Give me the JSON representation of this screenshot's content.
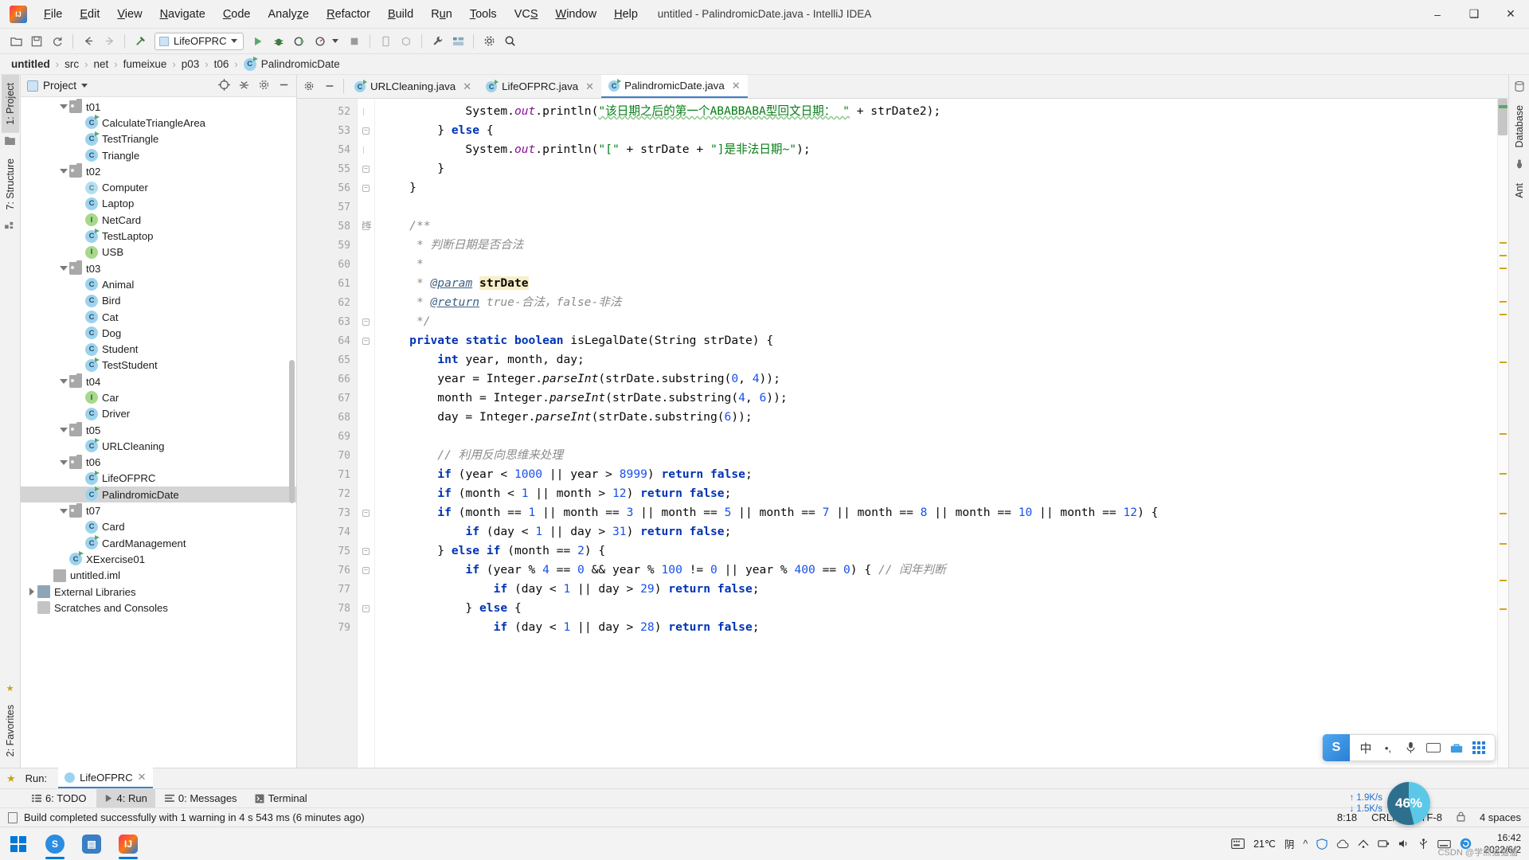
{
  "window": {
    "title": "untitled - PalindromicDate.java - IntelliJ IDEA",
    "minimize": "–",
    "maximize": "❐",
    "close": "✕"
  },
  "menu": [
    {
      "label": "File"
    },
    {
      "label": "Edit"
    },
    {
      "label": "View"
    },
    {
      "label": "Navigate"
    },
    {
      "label": "Code"
    },
    {
      "label": "Analyze"
    },
    {
      "label": "Refactor"
    },
    {
      "label": "Build"
    },
    {
      "label": "Run"
    },
    {
      "label": "Tools"
    },
    {
      "label": "VCS"
    },
    {
      "label": "Window"
    },
    {
      "label": "Help"
    }
  ],
  "toolbar": {
    "run_config": "LifeOFPRC",
    "icons": [
      "open-folder-icon",
      "save-icon",
      "sync-icon",
      "back-arrow-icon",
      "forward-arrow-icon",
      "build-hammer-icon"
    ],
    "right_icons": [
      "run-icon",
      "debug-icon",
      "run-with-coverage-icon",
      "profile-icon",
      "stop-icon",
      "device-icon",
      "avd-manager-icon",
      "wrench-icon",
      "structure-icon",
      "settings-gear-icon",
      "search-icon"
    ]
  },
  "breadcrumb": {
    "separator": "›",
    "items": [
      {
        "label": "untitled",
        "bold": true
      },
      {
        "label": "src"
      },
      {
        "label": "net"
      },
      {
        "label": "fumeixue"
      },
      {
        "label": "p03"
      },
      {
        "label": "t06"
      },
      {
        "label": "PalindromicDate",
        "icon": "java-class-runnable-icon"
      }
    ]
  },
  "left_rail": {
    "tabs": [
      {
        "label": "1: Project",
        "active": true
      },
      {
        "label": "7: Structure",
        "active": false
      }
    ],
    "bottom_tab": "2: Favorites"
  },
  "right_rail": {
    "tabs": [
      {
        "label": "Database"
      },
      {
        "label": "Ant"
      }
    ]
  },
  "project_panel": {
    "title": "Project",
    "locate_icon": "crosshair-icon",
    "collapse_icon": "collapse-all-icon",
    "gear_icon": "gear-icon",
    "hide_icon": "hide-icon",
    "tree": [
      {
        "label": "t01",
        "type": "folder",
        "indent": 2,
        "expanded": true
      },
      {
        "label": "CalculateTriangleArea",
        "type": "class-runnable",
        "indent": 3
      },
      {
        "label": "TestTriangle",
        "type": "class-runnable",
        "indent": 3
      },
      {
        "label": "Triangle",
        "type": "class",
        "indent": 3
      },
      {
        "label": "t02",
        "type": "folder",
        "indent": 2,
        "expanded": true
      },
      {
        "label": "Computer",
        "type": "class-abstract",
        "indent": 3
      },
      {
        "label": "Laptop",
        "type": "class",
        "indent": 3
      },
      {
        "label": "NetCard",
        "type": "interface",
        "indent": 3
      },
      {
        "label": "TestLaptop",
        "type": "class-runnable",
        "indent": 3
      },
      {
        "label": "USB",
        "type": "interface",
        "indent": 3
      },
      {
        "label": "t03",
        "type": "folder",
        "indent": 2,
        "expanded": true
      },
      {
        "label": "Animal",
        "type": "class",
        "indent": 3
      },
      {
        "label": "Bird",
        "type": "class",
        "indent": 3
      },
      {
        "label": "Cat",
        "type": "class",
        "indent": 3
      },
      {
        "label": "Dog",
        "type": "class",
        "indent": 3
      },
      {
        "label": "Student",
        "type": "class",
        "indent": 3
      },
      {
        "label": "TestStudent",
        "type": "class-runnable",
        "indent": 3
      },
      {
        "label": "t04",
        "type": "folder",
        "indent": 2,
        "expanded": true
      },
      {
        "label": "Car",
        "type": "interface",
        "indent": 3
      },
      {
        "label": "Driver",
        "type": "class",
        "indent": 3
      },
      {
        "label": "t05",
        "type": "folder",
        "indent": 2,
        "expanded": true
      },
      {
        "label": "URLCleaning",
        "type": "class-runnable",
        "indent": 3
      },
      {
        "label": "t06",
        "type": "folder",
        "indent": 2,
        "expanded": true
      },
      {
        "label": "LifeOFPRC",
        "type": "class-runnable",
        "indent": 3
      },
      {
        "label": "PalindromicDate",
        "type": "class-runnable",
        "indent": 3,
        "selected": true
      },
      {
        "label": "t07",
        "type": "folder",
        "indent": 2,
        "expanded": true
      },
      {
        "label": "Card",
        "type": "class",
        "indent": 3
      },
      {
        "label": "CardManagement",
        "type": "class-runnable",
        "indent": 3
      },
      {
        "label": "XExercise01",
        "type": "class-runnable",
        "indent": 2
      },
      {
        "label": "untitled.iml",
        "type": "iml",
        "indent": 1
      },
      {
        "label": "External Libraries",
        "type": "library",
        "indent": 0,
        "collapsed": true
      },
      {
        "label": "Scratches and Consoles",
        "type": "scratch",
        "indent": 0
      }
    ]
  },
  "editor": {
    "tabs": [
      {
        "label": "URLCleaning.java",
        "active": false,
        "close": "✕"
      },
      {
        "label": "LifeOFPRC.java",
        "active": false,
        "close": "✕"
      },
      {
        "label": "PalindromicDate.java",
        "active": true,
        "close": "✕"
      }
    ],
    "first_line_number": 52,
    "lines": [
      {
        "num": 52,
        "fold": "bar"
      },
      {
        "num": 53,
        "fold": "minus"
      },
      {
        "num": 54,
        "fold": "bar"
      },
      {
        "num": 55,
        "fold": "minus"
      },
      {
        "num": 56,
        "fold": "minus"
      },
      {
        "num": 57,
        "fold": ""
      },
      {
        "num": 58,
        "fold": "minus",
        "gutter_mark": "javadoc"
      },
      {
        "num": 59,
        "fold": ""
      },
      {
        "num": 60,
        "fold": ""
      },
      {
        "num": 61,
        "fold": ""
      },
      {
        "num": 62,
        "fold": ""
      },
      {
        "num": 63,
        "fold": "minus"
      },
      {
        "num": 64,
        "fold": "minus"
      },
      {
        "num": 65,
        "fold": ""
      },
      {
        "num": 66,
        "fold": ""
      },
      {
        "num": 67,
        "fold": ""
      },
      {
        "num": 68,
        "fold": ""
      },
      {
        "num": 69,
        "fold": ""
      },
      {
        "num": 70,
        "fold": ""
      },
      {
        "num": 71,
        "fold": ""
      },
      {
        "num": 72,
        "fold": ""
      },
      {
        "num": 73,
        "fold": "minus"
      },
      {
        "num": 74,
        "fold": ""
      },
      {
        "num": 75,
        "fold": "minus"
      },
      {
        "num": 76,
        "fold": "minus"
      },
      {
        "num": 77,
        "fold": ""
      },
      {
        "num": 78,
        "fold": "minus"
      },
      {
        "num": 79,
        "fold": ""
      }
    ],
    "code_text": [
      "            System.out.println(\"该日期之后的第一个ABABBABA型回文日期： \" + strDate2);",
      "        } else {",
      "            System.out.println(\"[\" + strDate + \"]是非法日期~\");",
      "        }",
      "    }",
      "",
      "    /**",
      "     * 判断日期是否合法",
      "     *",
      "     * @param strDate",
      "     * @return true-合法，false-非法",
      "     */",
      "    private static boolean isLegalDate(String strDate) {",
      "        int year, month, day;",
      "        year = Integer.parseInt(strDate.substring(0, 4));",
      "        month = Integer.parseInt(strDate.substring(4, 6));",
      "        day = Integer.parseInt(strDate.substring(6));",
      "",
      "        // 利用反向思维来处理",
      "        if (year < 1000 || year > 8999) return false;",
      "        if (month < 1 || month > 12) return false;",
      "        if (month == 1 || month == 3 || month == 5 || month == 7 || month == 8 || month == 10 || month == 12) {",
      "            if (day < 1 || day > 31) return false;",
      "        } else if (month == 2) {",
      "            if (year % 4 == 0 && year % 100 != 0 || year % 400 == 0) { // 闰年判断",
      "                if (day < 1 || day > 29) return false;",
      "            } else {",
      "                if (day < 1 || day > 28) return false;"
    ]
  },
  "ime": {
    "logo": "S",
    "mode_label": "中",
    "items": [
      "sogou-logo-icon",
      "chinese-mode-icon",
      "punctuation-icon",
      "microphone-icon",
      "keyboard-icon",
      "toolbox-icon",
      "menu-grid-icon"
    ]
  },
  "run_panel": {
    "label": "Run:",
    "tab_label": "LifeOFPRC",
    "close": "✕"
  },
  "bottom_tools": [
    {
      "label": "6: TODO",
      "icon": "todo-list-icon",
      "active": false
    },
    {
      "label": "4: Run",
      "icon": "run-triangle-icon",
      "active": true
    },
    {
      "label": "0: Messages",
      "icon": "messages-icon",
      "active": false
    },
    {
      "label": "Terminal",
      "icon": "terminal-icon",
      "active": false
    }
  ],
  "statusbar": {
    "message": "Build completed successfully with 1 warning in 4 s 543 ms (6 minutes ago)",
    "caret_position": "8:18",
    "line_separator": "CRLF",
    "encoding": "UTF-8",
    "indent": "4 spaces",
    "lock_icon": "lock-icon",
    "event_log_icon": "event-log-icon"
  },
  "taskbar": {
    "start_icon": "windows-start-icon",
    "apps": [
      {
        "name": "sogou-browser-icon",
        "letter": "S",
        "color": "#2b8de0",
        "active": true
      },
      {
        "name": "file-explorer-icon",
        "letter": "▤",
        "color": "#3a7fc4",
        "active": false
      },
      {
        "name": "intellij-idea-icon",
        "letter": "IJ",
        "color": "#f4552a",
        "active": true
      }
    ],
    "tray": {
      "ime_icon": "ime-icon",
      "temperature": "21℃",
      "weather": "阴",
      "up_arrow": "向上",
      "icons": [
        "shield-icon",
        "cloud-icon",
        "network-icon",
        "battery-icon",
        "volume-icon",
        "usb-icon",
        "keyboard-tray-icon",
        "sogou-tray-icon"
      ],
      "time": "16:42",
      "date": "2022/6/2"
    }
  },
  "netspeed": {
    "upload": "1.9K/s",
    "download": "1.5K/s",
    "percent": "46%"
  },
  "watermark": "CSDN @学熊猫猫猫",
  "colors": {
    "accent": "#3d7ecc",
    "keyword": "#0033b3",
    "string": "#067d17",
    "number": "#1750eb",
    "comment": "#8c8c8c",
    "selection": "#d4d4d4",
    "runnable_green": "#59a869",
    "class_blue": "#9cd3ee",
    "interface_green": "#a6d98a"
  }
}
